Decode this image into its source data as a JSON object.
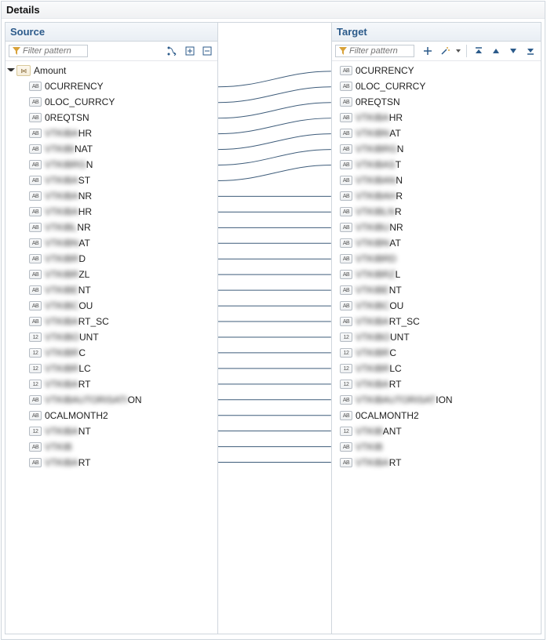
{
  "panelTitle": "Details",
  "source": {
    "header": "Source",
    "filterPlaceholder": "Filter pattern",
    "toolbar": {
      "autoMap": "Auto-map",
      "expandAll": "Expand all",
      "collapseAll": "Collapse all"
    },
    "root": {
      "label": "Amount",
      "type": "grp"
    },
    "items": [
      {
        "type": "AB",
        "label": "0CURRENCY",
        "blur": false
      },
      {
        "type": "AB",
        "label": "0LOC_CURRCY",
        "blur": false
      },
      {
        "type": "AB",
        "label": "0REQTSN",
        "blur": false
      },
      {
        "type": "AB",
        "label": "VTKIBAHR",
        "suffix": "HR",
        "blur": true
      },
      {
        "type": "AB",
        "label": "VTKIBINAT",
        "suffix": "NAT",
        "blur": true
      },
      {
        "type": "AB",
        "label": "VTKIBRGN",
        "suffix": "N",
        "blur": true
      },
      {
        "type": "AB",
        "label": "VTKIBAST",
        "suffix": "ST",
        "blur": true
      },
      {
        "type": "AB",
        "label": "VTKIBANR",
        "suffix": "NR",
        "blur": true
      },
      {
        "type": "AB",
        "label": "VTKIBAHR",
        "suffix": "HR",
        "blur": true
      },
      {
        "type": "AB",
        "label": "VTKIBLNR",
        "suffix": "NR",
        "blur": true
      },
      {
        "type": "AB",
        "label": "VTKIBNAT",
        "suffix": "AT",
        "blur": true
      },
      {
        "type": "AB",
        "label": "VTKIBRD",
        "suffix": "D",
        "blur": true
      },
      {
        "type": "AB",
        "label": "VTKIBRZL",
        "suffix": "ZL",
        "blur": true
      },
      {
        "type": "AB",
        "label": "VTKIBENT",
        "suffix": "NT",
        "blur": true
      },
      {
        "type": "AB",
        "label": "VTKIBCOU",
        "suffix": "OU",
        "blur": true
      },
      {
        "type": "AB",
        "label": "VTKIBART_SC",
        "suffix": "RT_SC",
        "blur": true
      },
      {
        "type": "12",
        "label": "VTKIBOUNT",
        "suffix": "UNT",
        "blur": true
      },
      {
        "type": "12",
        "label": "VTKIBRC",
        "suffix": "C",
        "blur": true
      },
      {
        "type": "12",
        "label": "VTKIBRLC",
        "suffix": "LC",
        "blur": true
      },
      {
        "type": "12",
        "label": "VTKIBART",
        "suffix": "RT",
        "blur": true
      },
      {
        "type": "AB",
        "label": "VTKIBAUTORISATION",
        "suffix": "ON",
        "blur": true
      },
      {
        "type": "AB",
        "label": "0CALMONTH2",
        "blur": false
      },
      {
        "type": "12",
        "label": "VTKIBANT",
        "suffix": "NT",
        "blur": true
      },
      {
        "type": "AB",
        "label": "VTKIB",
        "suffix": "",
        "blur": true
      },
      {
        "type": "AB",
        "label": "VTKIBART",
        "suffix": "RT",
        "blur": true
      }
    ]
  },
  "target": {
    "header": "Target",
    "filterPlaceholder": "Filter pattern",
    "toolbar": {
      "add": "Add",
      "wand": "Auto-fix",
      "top": "Move top",
      "up": "Move up",
      "down": "Move down",
      "bottom": "Move bottom"
    },
    "items": [
      {
        "type": "AB",
        "label": "0CURRENCY",
        "blur": false
      },
      {
        "type": "AB",
        "label": "0LOC_CURRCY",
        "blur": false
      },
      {
        "type": "AB",
        "label": "0REQTSN",
        "blur": false
      },
      {
        "type": "AB",
        "label": "VTKIBAHR",
        "suffix": "HR",
        "blur": true
      },
      {
        "type": "AB",
        "label": "VTKIBNAT",
        "suffix": "AT",
        "blur": true
      },
      {
        "type": "AB",
        "label": "VTKIBRGN",
        "suffix": "N",
        "blur": true
      },
      {
        "type": "AB",
        "label": "VTKIBAST",
        "suffix": "T",
        "blur": true
      },
      {
        "type": "AB",
        "label": "VTKIBANR",
        "suffix": "N",
        "blur": true
      },
      {
        "type": "AB",
        "label": "VTKIBAHR",
        "suffix": "R",
        "blur": true
      },
      {
        "type": "AB",
        "label": "VTKIBLNR",
        "suffix": "R",
        "blur": true
      },
      {
        "type": "AB",
        "label": "VTKIBUNR",
        "suffix": "NR",
        "blur": true
      },
      {
        "type": "AB",
        "label": "VTKIBNAT",
        "suffix": "AT",
        "blur": true
      },
      {
        "type": "AB",
        "label": "VTKIBRD",
        "suffix": "",
        "blur": true
      },
      {
        "type": "AB",
        "label": "VTKIBRZL",
        "suffix": "L",
        "blur": true
      },
      {
        "type": "AB",
        "label": "VTKIBENT",
        "suffix": "NT",
        "blur": true
      },
      {
        "type": "AB",
        "label": "VTKIBCOU",
        "suffix": "OU",
        "blur": true
      },
      {
        "type": "AB",
        "label": "VTKIBART_SC",
        "suffix": "RT_SC",
        "blur": true
      },
      {
        "type": "12",
        "label": "VTKIBOUNT",
        "suffix": "UNT",
        "blur": true
      },
      {
        "type": "12",
        "label": "VTKIBRC",
        "suffix": "C",
        "blur": true
      },
      {
        "type": "12",
        "label": "VTKIBRLC",
        "suffix": "LC",
        "blur": true
      },
      {
        "type": "12",
        "label": "VTKIBART",
        "suffix": "RT",
        "blur": true
      },
      {
        "type": "AB",
        "label": "VTKIBAUTORISATION",
        "suffix": "ION",
        "blur": true
      },
      {
        "type": "AB",
        "label": "0CALMONTH2",
        "blur": false
      },
      {
        "type": "12",
        "label": "VTKIBANT",
        "suffix": "ANT",
        "blur": true
      },
      {
        "type": "AB",
        "label": "VTKIB",
        "suffix": "",
        "blur": true
      },
      {
        "type": "AB",
        "label": "VTKIBART",
        "suffix": "RT",
        "blur": true
      }
    ]
  },
  "mappings": [
    [
      0,
      0
    ],
    [
      1,
      1
    ],
    [
      2,
      2
    ],
    [
      3,
      3
    ],
    [
      4,
      4
    ],
    [
      5,
      5
    ],
    [
      6,
      6
    ],
    [
      7,
      8
    ],
    [
      8,
      9
    ],
    [
      9,
      10
    ],
    [
      10,
      11
    ],
    [
      11,
      12
    ],
    [
      12,
      13
    ],
    [
      13,
      14
    ],
    [
      14,
      15
    ],
    [
      15,
      16
    ],
    [
      16,
      17
    ],
    [
      17,
      18
    ],
    [
      18,
      19
    ],
    [
      19,
      20
    ],
    [
      20,
      21
    ],
    [
      21,
      22
    ],
    [
      22,
      23
    ],
    [
      23,
      24
    ],
    [
      24,
      25
    ]
  ]
}
